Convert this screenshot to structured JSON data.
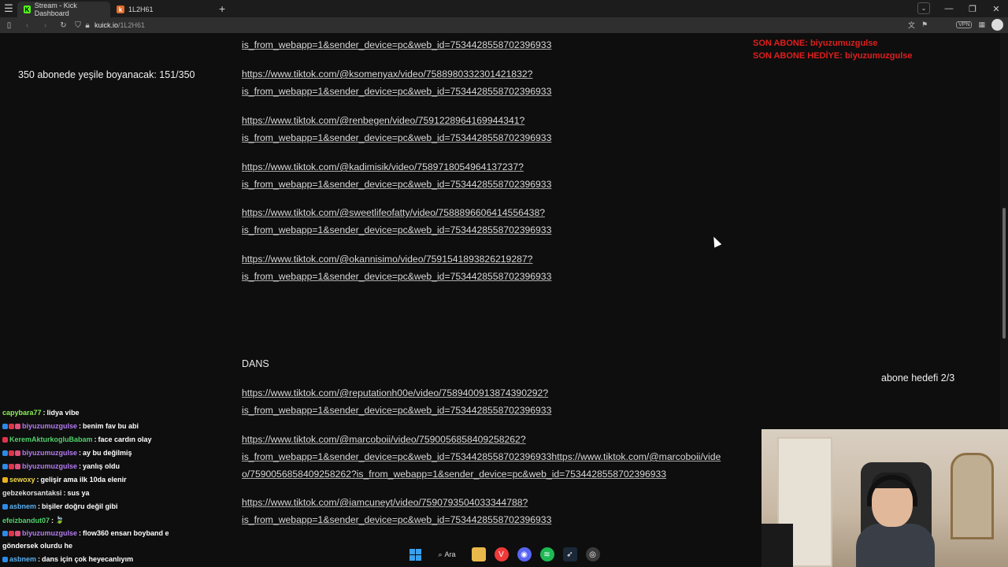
{
  "browser": {
    "tabs": [
      {
        "label": "Stream - Kick Dashboard",
        "icon": "kick-favicon-icon"
      },
      {
        "label": "1L2H61",
        "icon": "k-favicon-icon"
      }
    ],
    "url_host": "kuick.io",
    "url_path": "/1L2H61"
  },
  "overlay": {
    "sub_goal": "350 abonede yeşile boyanacak: 151/350",
    "son_abone": "SON ABONE: biyuzumuzgulse",
    "son_abone_hediye": "SON ABONE HEDİYE: biyuzumuzgulse",
    "abone_hedefi": "abone hedefi 2/3"
  },
  "page": {
    "section_label": "DANS",
    "link_lines": [
      "is_from_webapp=1&sender_device=pc&web_id=7534428558702396933",
      "https://www.tiktok.com/@ksomenyax/video/7588980332301421832?",
      "is_from_webapp=1&sender_device=pc&web_id=7534428558702396933",
      "https://www.tiktok.com/@renbegen/video/7591228964169944341?",
      "is_from_webapp=1&sender_device=pc&web_id=7534428558702396933",
      "https://www.tiktok.com/@kadimisik/video/7589718054964137237?",
      "is_from_webapp=1&sender_device=pc&web_id=7534428558702396933",
      "https://www.tiktok.com/@sweetlifeofatty/video/7588896606414556438?",
      "is_from_webapp=1&sender_device=pc&web_id=7534428558702396933",
      "https://www.tiktok.com/@okannisimo/video/7591541893826219287?",
      "is_from_webapp=1&sender_device=pc&web_id=7534428558702396933"
    ],
    "dans_link_lines": [
      "https://www.tiktok.com/@reputationh00e/video/7589400913874390292?",
      "is_from_webapp=1&sender_device=pc&web_id=7534428558702396933",
      "https://www.tiktok.com/@marcoboii/video/7590056858409258262?",
      "is_from_webapp=1&sender_device=pc&web_id=7534428558702396933https://www.tiktok.com/@marcoboii/vide",
      "o/7590056858409258262?is_from_webapp=1&sender_device=pc&web_id=7534428558702396933",
      "https://www.tiktok.com/@iamcuneyt/video/7590793504033344788?",
      "is_from_webapp=1&sender_device=pc&web_id=7534428558702396933"
    ]
  },
  "chat": [
    {
      "user": "capybara77",
      "color": "#8cf05a",
      "text": "lidya vibe",
      "badges": []
    },
    {
      "user": "biyuzumuzgulse",
      "color": "#b57cf0",
      "text": "benim fav bu abi",
      "badges": [
        "blue",
        "red",
        "pink"
      ]
    },
    {
      "user": "KeremAkturkogluBabam",
      "color": "#4fd26a",
      "text": "face cardın olay",
      "badges": [
        "red"
      ]
    },
    {
      "user": "biyuzumuzgulse",
      "color": "#b57cf0",
      "text": "ay bu değilmiş",
      "badges": [
        "blue",
        "red",
        "pink"
      ]
    },
    {
      "user": "biyuzumuzgulse",
      "color": "#b57cf0",
      "text": "yanlış oldu",
      "badges": [
        "blue",
        "red",
        "pink"
      ]
    },
    {
      "user": "sewoxy",
      "color": "#f0d84a",
      "text": "gelişir ama ilk 10da elenir",
      "badges": [
        "yellow"
      ]
    },
    {
      "user": "gebzekorsantaksi",
      "color": "#e0e0e0",
      "text": "sus ya",
      "badges": []
    },
    {
      "user": "asbnem",
      "color": "#5ab0f0",
      "text": "bişiler doğru değil gibi",
      "badges": [
        "blue"
      ]
    },
    {
      "user": "efeizbandut07",
      "color": "#4fd26a",
      "text": "🍃",
      "badges": []
    },
    {
      "user": "biyuzumuzgulse",
      "color": "#b57cf0",
      "text": "flow360 ensarı boyband e",
      "badges": [
        "blue",
        "red",
        "pink"
      ]
    },
    {
      "user": "",
      "color": "#ffffff",
      "text": "göndersek olurdu he",
      "badges": []
    },
    {
      "user": "asbnem",
      "color": "#5ab0f0",
      "text": "dans için çok heyecanlıyım",
      "badges": [
        "blue"
      ]
    }
  ],
  "taskbar": {
    "search_label": "Ara"
  },
  "colors": {
    "son_abone": "#e01e1e",
    "page_bg": "#0e0e0e"
  }
}
